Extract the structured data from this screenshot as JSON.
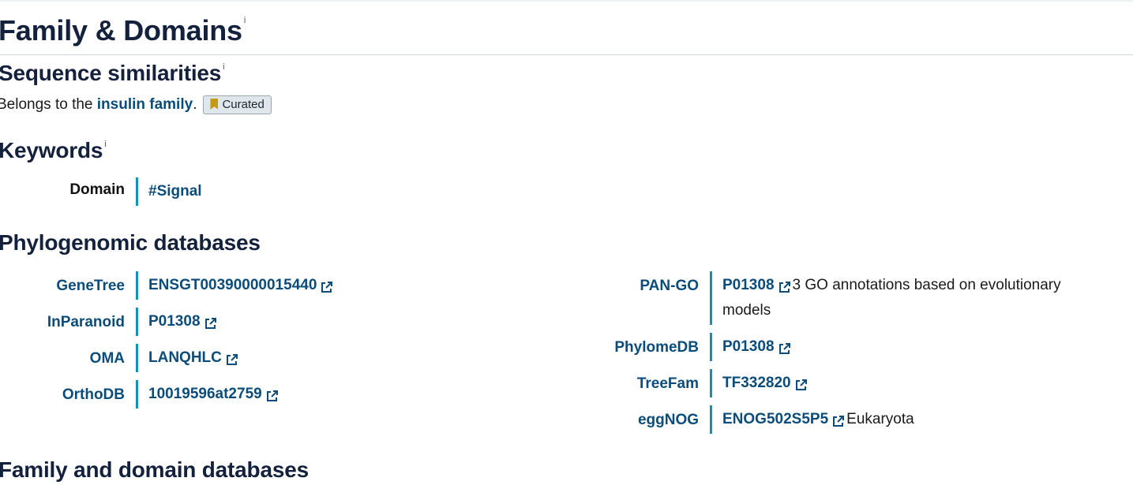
{
  "section_title": "Family & Domains",
  "info_marker": "i",
  "similarity": {
    "title": "Sequence similarities",
    "prefix": "Belongs to the ",
    "link": "insulin family",
    "suffix": ".",
    "badge": "Curated"
  },
  "keywords": {
    "title": "Keywords",
    "label": "Domain",
    "value": "#Signal"
  },
  "phylogenomic": {
    "title": "Phylogenomic databases",
    "left": [
      {
        "label": "GeneTree",
        "value": "ENSGT00390000015440"
      },
      {
        "label": "InParanoid",
        "value": "P01308"
      },
      {
        "label": "OMA",
        "value": "LANQHLC"
      },
      {
        "label": "OrthoDB",
        "value": "10019596at2759"
      }
    ],
    "right": [
      {
        "label": "PAN-GO",
        "value": "P01308",
        "note": "3 GO annotations based on evolutionary models"
      },
      {
        "label": "PhylomeDB",
        "value": "P01308"
      },
      {
        "label": "TreeFam",
        "value": "TF332820"
      },
      {
        "label": "eggNOG",
        "value": "ENOG502S5P5",
        "note": "Eukaryota"
      }
    ]
  },
  "family_domain_title": "Family and domain databases",
  "colors": {
    "link": "#0b4c7a",
    "accent": "#0e93b6",
    "heading": "#14213d",
    "badge_icon": "#c39a18"
  },
  "icons": {
    "external": "external-link-icon",
    "bookmark": "bookmark-icon"
  }
}
